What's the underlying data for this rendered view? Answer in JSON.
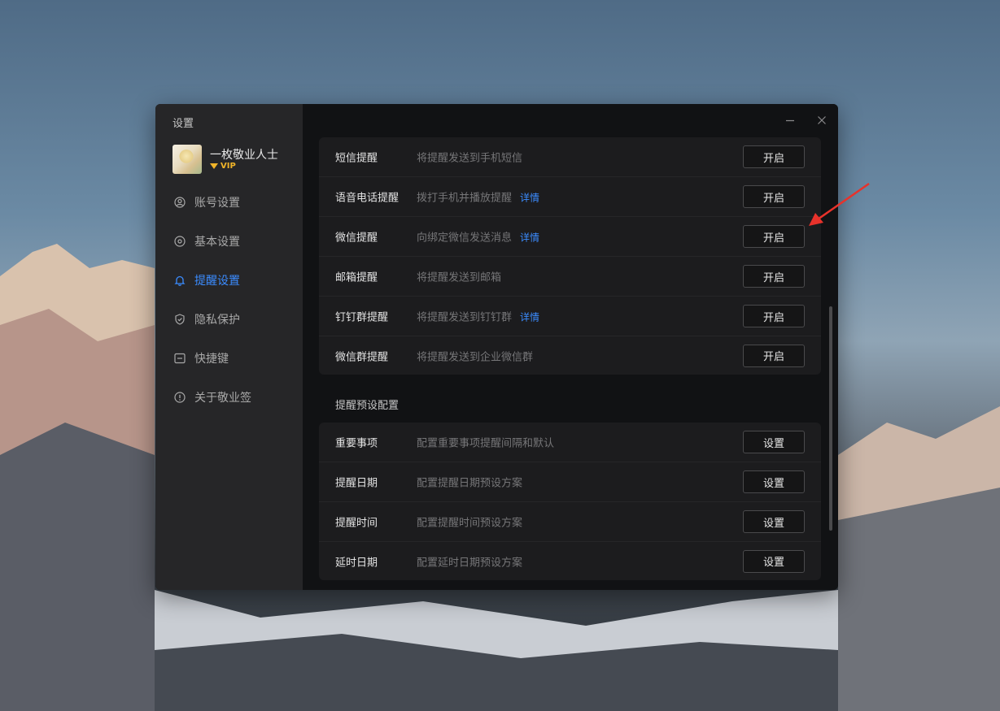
{
  "window": {
    "title": "设置",
    "controls": {
      "minimize": "minimize-icon",
      "close": "close-icon"
    }
  },
  "profile": {
    "name": "一枚敬业人士",
    "badge": "VIP"
  },
  "sidebar": {
    "items": [
      {
        "label": "账号设置",
        "icon": "user-circle-icon",
        "active": false
      },
      {
        "label": "基本设置",
        "icon": "gear-icon",
        "active": false
      },
      {
        "label": "提醒设置",
        "icon": "bell-icon",
        "active": true
      },
      {
        "label": "隐私保护",
        "icon": "shield-icon",
        "active": false
      },
      {
        "label": "快捷键",
        "icon": "keyboard-icon",
        "active": false
      },
      {
        "label": "关于敬业签",
        "icon": "info-icon",
        "active": false
      }
    ]
  },
  "notify": {
    "rows": [
      {
        "label": "短信提醒",
        "desc": "将提醒发送到手机短信",
        "detail": "",
        "button": "开启"
      },
      {
        "label": "语音电话提醒",
        "desc": "拨打手机并播放提醒",
        "detail": "详情",
        "button": "开启"
      },
      {
        "label": "微信提醒",
        "desc": "向绑定微信发送消息",
        "detail": "详情",
        "button": "开启"
      },
      {
        "label": "邮箱提醒",
        "desc": "将提醒发送到邮箱",
        "detail": "",
        "button": "开启"
      },
      {
        "label": "钉钉群提醒",
        "desc": "将提醒发送到钉钉群",
        "detail": "详情",
        "button": "开启"
      },
      {
        "label": "微信群提醒",
        "desc": "将提醒发送到企业微信群",
        "detail": "",
        "button": "开启"
      }
    ]
  },
  "presets": {
    "title": "提醒预设配置",
    "rows": [
      {
        "label": "重要事项",
        "desc": "配置重要事项提醒间隔和默认",
        "button": "设置"
      },
      {
        "label": "提醒日期",
        "desc": "配置提醒日期预设方案",
        "button": "设置"
      },
      {
        "label": "提醒时间",
        "desc": "配置提醒时间预设方案",
        "button": "设置"
      },
      {
        "label": "延时日期",
        "desc": "配置延时日期预设方案",
        "button": "设置"
      }
    ]
  },
  "colors": {
    "accent": "#3b8cff",
    "vip": "#f0b429",
    "annotation_arrow": "#e8322b"
  }
}
